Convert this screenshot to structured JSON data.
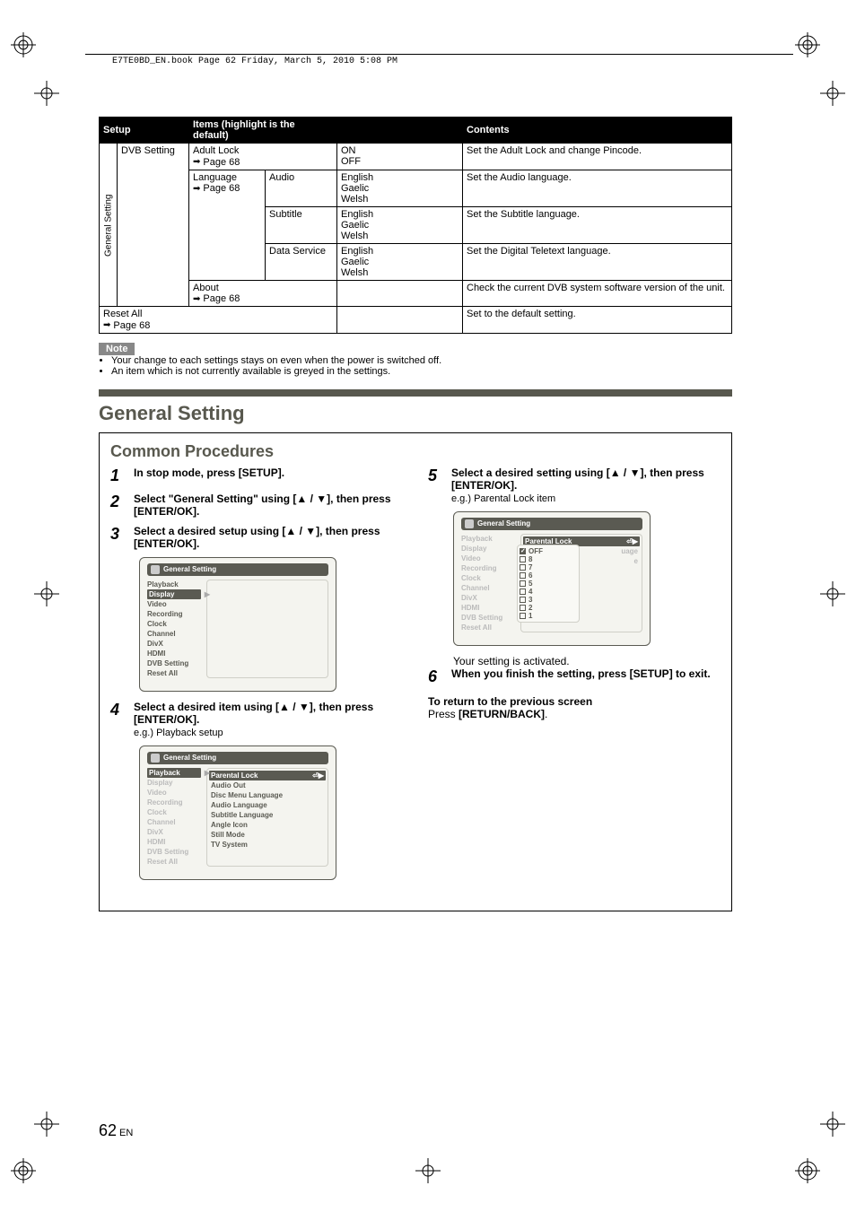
{
  "meta": {
    "header_text": "E7TE0BD_EN.book  Page 62  Friday, March 5, 2010  5:08 PM"
  },
  "table": {
    "headers": {
      "setup": "Setup",
      "items": "Items (highlight is the default)",
      "contents": "Contents"
    },
    "side_label": "General Setting",
    "group": "DVB Setting",
    "rows": [
      {
        "item": "Adult Lock",
        "ref": "Page 68",
        "sub": "",
        "opts": "ON\nOFF",
        "desc": "Set the Adult Lock and change Pincode."
      },
      {
        "item": "Language",
        "ref": "Page 68",
        "sub": "Audio",
        "opts": "English\nGaelic\nWelsh",
        "desc": "Set the Audio language."
      },
      {
        "item": "",
        "ref": "",
        "sub": "Subtitle",
        "opts": "English\nGaelic\nWelsh",
        "desc": "Set the Subtitle language."
      },
      {
        "item": "",
        "ref": "",
        "sub": "Data Service",
        "opts": "English\nGaelic\nWelsh",
        "desc": "Set the Digital Teletext language."
      },
      {
        "item": "About",
        "ref": "Page 68",
        "sub": "",
        "opts": "",
        "desc": "Check the current DVB system software version of the unit."
      }
    ],
    "reset": {
      "label": "Reset All",
      "ref": "Page 68",
      "desc": "Set to the default setting."
    }
  },
  "note": {
    "label": "Note",
    "items": [
      "Your change to each settings stays on even when the power is switched off.",
      "An item which is not currently available is greyed in the settings."
    ]
  },
  "section": {
    "title": "General Setting",
    "proc_title": "Common Procedures"
  },
  "steps": {
    "s1": "In stop mode, press [SETUP].",
    "s2": "Select \"General Setting\" using [▲ / ▼], then press [ENTER/OK].",
    "s3": "Select a desired setup using [▲ / ▼], then press [ENTER/OK].",
    "s4": "Select a desired item using [▲ / ▼], then press [ENTER/OK].",
    "s4_sub": "e.g.) Playback setup",
    "s5": "Select a desired setting using [▲ / ▼], then press [ENTER/OK].",
    "s5_sub": "e.g.) Parental Lock item",
    "s5_after": "Your setting is activated.",
    "s6": "When you finish the setting, press [SETUP] to exit."
  },
  "osd": {
    "title": "General Setting",
    "menu": [
      "Playback",
      "Display",
      "Video",
      "Recording",
      "Clock",
      "Channel",
      "DivX",
      "HDMI",
      "DVB Setting",
      "Reset All"
    ],
    "panel2_items": [
      "Parental Lock",
      "Audio Out",
      "Disc Menu Language",
      "Audio Language",
      "Subtitle Language",
      "Angle Icon",
      "Still Mode",
      "TV System"
    ],
    "panel3_item": "Parental Lock",
    "panel3_opts": [
      "OFF",
      "8",
      "7",
      "6",
      "5",
      "4",
      "3",
      "2",
      "1"
    ],
    "panel3_peek": [
      "",
      "",
      "",
      "uage",
      "",
      "e",
      "",
      "",
      ""
    ]
  },
  "return": {
    "head": "To return to the previous screen",
    "body_pre": "Press ",
    "body_bold": "[RETURN/BACK]",
    "body_post": "."
  },
  "footer": {
    "page": "62",
    "lang": "EN"
  }
}
